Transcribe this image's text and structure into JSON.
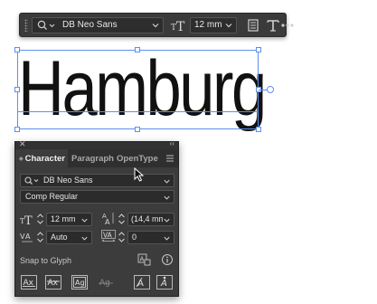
{
  "context_bar": {
    "font_family": "DB Neo Sans",
    "font_size": "12 mm"
  },
  "canvas": {
    "frame_text": "Hamburg"
  },
  "character_panel": {
    "tabs": [
      {
        "label": "Character"
      },
      {
        "label": "Paragraph"
      },
      {
        "label": "OpenType"
      }
    ],
    "font_family": "DB Neo Sans",
    "font_style": "Comp Regular",
    "font_size": "12 mm",
    "leading": "(14,4 mm",
    "kerning": "Auto",
    "tracking": "0",
    "snap_to_glyph_label": "Snap to Glyph"
  }
}
